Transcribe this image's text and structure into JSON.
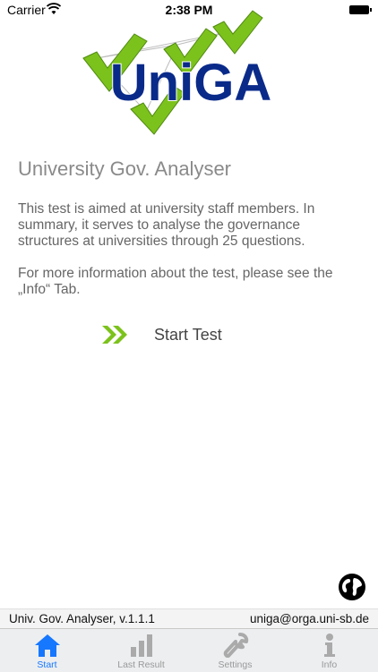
{
  "status_bar": {
    "carrier": "Carrier",
    "time": "2:38 PM"
  },
  "logo": {
    "text": "UniGA"
  },
  "main": {
    "title": "University Gov. Analyser",
    "description": "This test is aimed at university staff members. In summary, it serves to analyse the governance structures at universities through 25 questions.",
    "more_info": "For more information about the test, please see the „Info“ Tab.",
    "start_label": "Start Test"
  },
  "footer": {
    "version": "Univ. Gov. Analyser, v.1.1.1",
    "email": "uniga@orga.uni-sb.de"
  },
  "tabs": [
    {
      "label": "Start",
      "icon": "home-icon",
      "active": true
    },
    {
      "label": "Last Result",
      "icon": "bar-chart-icon",
      "active": false
    },
    {
      "label": "Settings",
      "icon": "wrench-icon",
      "active": false
    },
    {
      "label": "Info",
      "icon": "info-icon",
      "active": false
    }
  ],
  "colors": {
    "accent": "#1677ff",
    "logo_blue": "#0a2a8a",
    "check_green": "#7cc21c"
  }
}
